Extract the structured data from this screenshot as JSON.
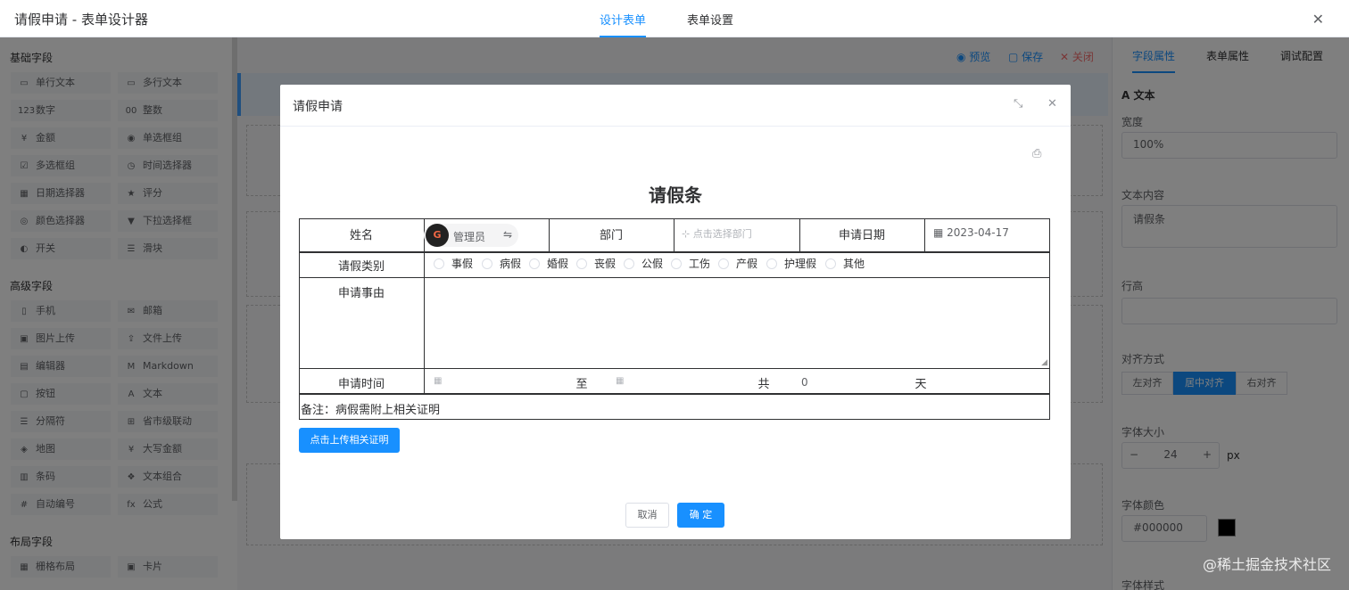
{
  "app_title": "请假申请 - 表单设计器",
  "top_tabs": [
    "设计表单",
    "表单设置"
  ],
  "left_panel": {
    "groups": [
      {
        "title": "基础字段",
        "items": [
          {
            "label": "单行文本",
            "icon": "▭"
          },
          {
            "label": "多行文本",
            "icon": "▭"
          },
          {
            "label": "数字",
            "icon": "123"
          },
          {
            "label": "整数",
            "icon": "00"
          },
          {
            "label": "金额",
            "icon": "¥"
          },
          {
            "label": "单选框组",
            "icon": "◉"
          },
          {
            "label": "多选框组",
            "icon": "☑"
          },
          {
            "label": "时间选择器",
            "icon": "◷"
          },
          {
            "label": "日期选择器",
            "icon": "▦"
          },
          {
            "label": "评分",
            "icon": "★"
          },
          {
            "label": "颜色选择器",
            "icon": "◎"
          },
          {
            "label": "下拉选择框",
            "icon": "▼"
          },
          {
            "label": "开关",
            "icon": "◐"
          },
          {
            "label": "滑块",
            "icon": "☰"
          }
        ]
      },
      {
        "title": "高级字段",
        "items": [
          {
            "label": "手机",
            "icon": "▯"
          },
          {
            "label": "邮箱",
            "icon": "✉"
          },
          {
            "label": "图片上传",
            "icon": "▣"
          },
          {
            "label": "文件上传",
            "icon": "⇪"
          },
          {
            "label": "编辑器",
            "icon": "▤"
          },
          {
            "label": "Markdown",
            "icon": "M"
          },
          {
            "label": "按钮",
            "icon": "▢"
          },
          {
            "label": "文本",
            "icon": "A"
          },
          {
            "label": "分隔符",
            "icon": "☰"
          },
          {
            "label": "省市级联动",
            "icon": "⊞"
          },
          {
            "label": "地图",
            "icon": "◈"
          },
          {
            "label": "大写金额",
            "icon": "¥"
          },
          {
            "label": "条码",
            "icon": "▥"
          },
          {
            "label": "文本组合",
            "icon": "❖"
          },
          {
            "label": "自动编号",
            "icon": "#"
          },
          {
            "label": "公式",
            "icon": "fx"
          }
        ]
      },
      {
        "title": "布局字段",
        "items": [
          {
            "label": "栅格布局",
            "icon": "▦"
          },
          {
            "label": "卡片",
            "icon": "▣"
          }
        ]
      }
    ]
  },
  "toolbar": {
    "preview": "预览",
    "save": "保存",
    "close": "关闭"
  },
  "right_panel": {
    "tabs": [
      "字段属性",
      "表单属性",
      "调试配置"
    ],
    "type_label": "文本",
    "width_label": "宽度",
    "width_value": "100%",
    "content_label": "文本内容",
    "content_value": "请假条",
    "line_height_label": "行高",
    "align_label": "对齐方式",
    "align_options": [
      "左对齐",
      "居中对齐",
      "右对齐"
    ],
    "font_size_label": "字体大小",
    "font_size_value": "24",
    "font_size_unit": "px",
    "font_color_label": "字体颜色",
    "font_color_value": "#000000",
    "font_style_label": "字体样式"
  },
  "dialog": {
    "title": "请假申请",
    "form_title": "请假条",
    "labels": {
      "name": "姓名",
      "dept": "部门",
      "apply_date": "申请日期",
      "leave_type": "请假类别",
      "reason": "申请事由",
      "apply_time": "申请时间",
      "to": "至",
      "total": "共",
      "days": "天"
    },
    "user_name": "管理员",
    "dept_placeholder": "点击选择部门",
    "date_value": "2023-04-17",
    "days_value": "0",
    "leave_types": [
      "事假",
      "病假",
      "婚假",
      "丧假",
      "公假",
      "工伤",
      "产假",
      "护理假",
      "其他"
    ],
    "note": "备注：病假需附上相关证明",
    "upload_button": "点击上传相关证明",
    "cancel": "取消",
    "ok": "确 定"
  },
  "watermark": "@稀土掘金技术社区",
  "colors": {
    "primary": "#1890ff",
    "danger": "#f56c6c"
  }
}
